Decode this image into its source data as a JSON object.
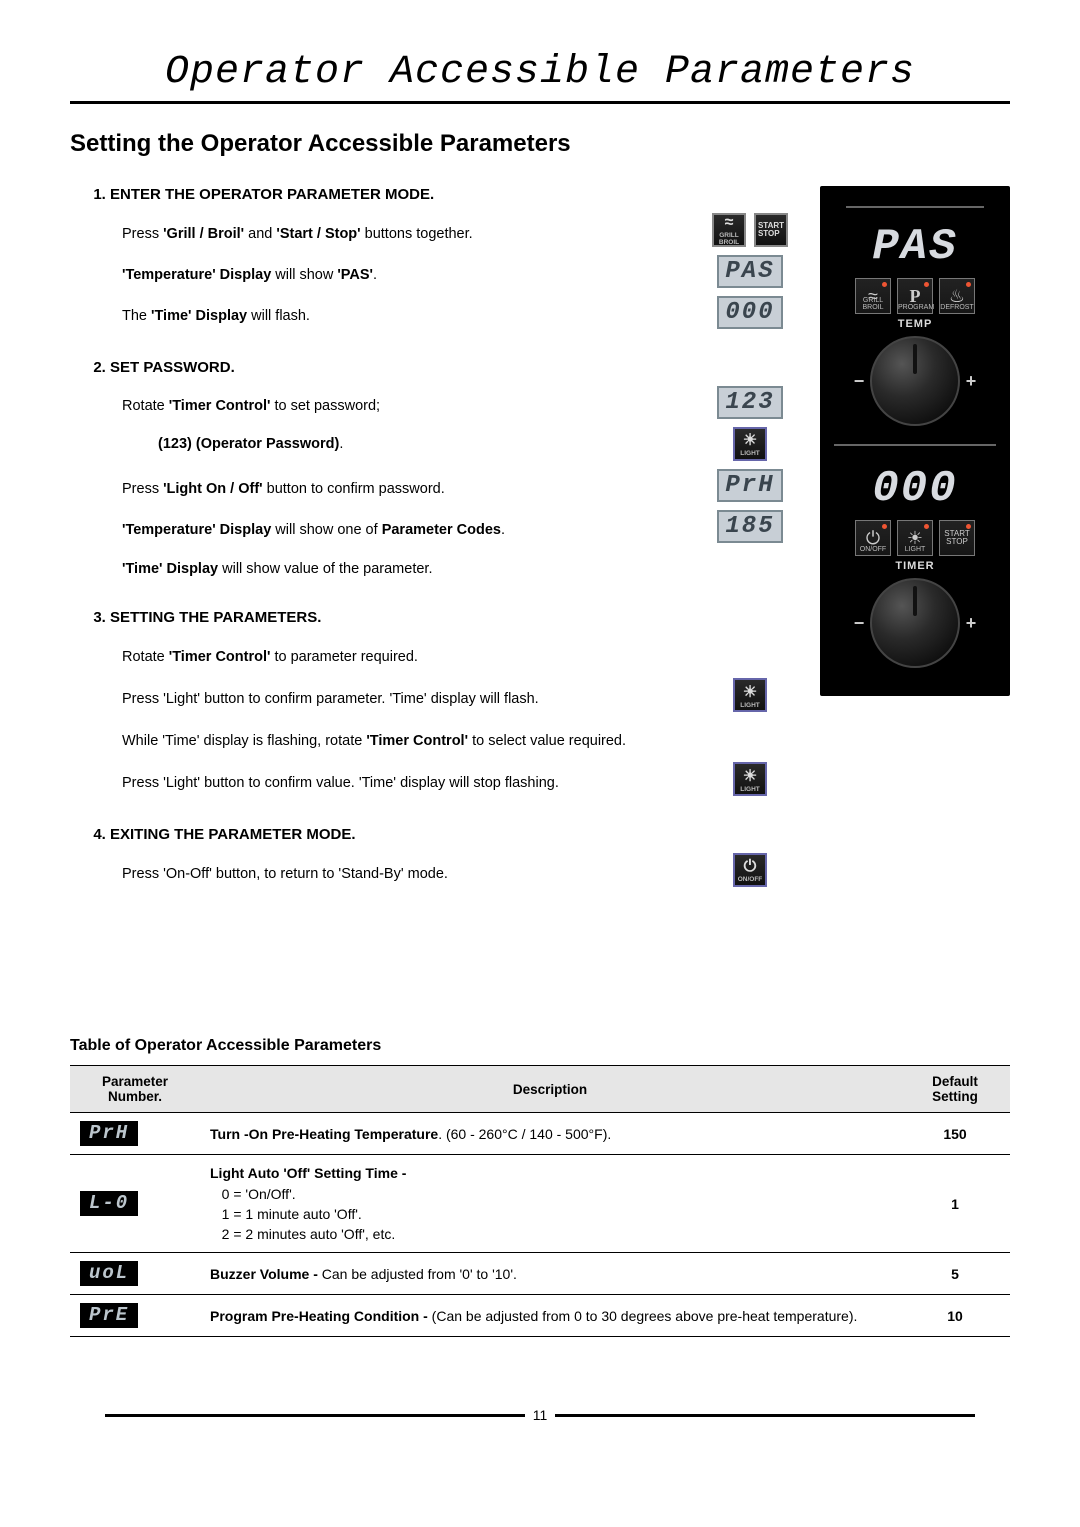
{
  "page": {
    "title": "Operator Accessible Parameters",
    "section_title": "Setting the Operator Accessible Parameters",
    "table_title": "Table of Operator Accessible Parameters",
    "number": "11"
  },
  "steps": [
    {
      "title": "Enter the Operator Parameter Mode.",
      "lines": [
        {
          "html": "Press <b>'Grill / Broil'</b> and <b>'Start / Stop'</b> buttons together."
        },
        {
          "html": "<b>'Temperature' Display</b> will show <b>'PAS'</b>."
        },
        {
          "html": "The <b>'Time' Display</b> will flash."
        }
      ],
      "icons": [
        "grill-start-pair",
        "lcd-PAS",
        "lcd-000"
      ]
    },
    {
      "title": "Set Password.",
      "lines": [
        {
          "html": "Rotate <b>'Timer Control'</b> to set password;"
        },
        {
          "html": "<span class='indent-sub'>(123) (Operator Password)</span>.",
          "raw": true
        },
        {
          "html": "Press <b>'Light On / Off'</b> button to confirm password."
        },
        {
          "html": "<b>'Temperature' Display</b> will show one of <b>Parameter Codes</b>."
        },
        {
          "html": "<b>'Time' Display</b> will show value of the parameter."
        }
      ],
      "icons": [
        "lcd-123",
        "light-btn",
        "lcd-PrH",
        "lcd-185"
      ]
    },
    {
      "title": "Setting the Parameters.",
      "lines": [
        {
          "html": "Rotate <b>'Timer Control'</b> to parameter required."
        },
        {
          "html": "Press 'Light' button to confirm parameter.  'Time' display will flash."
        },
        {
          "html": "While 'Time' display is flashing, rotate <b>'Timer Control'</b> to select value required."
        },
        {
          "html": "Press 'Light' button to confirm value.  'Time' display will stop flashing."
        }
      ],
      "icons": [
        "blank",
        "light-btn",
        "blank",
        "light-btn"
      ]
    },
    {
      "title": "Exiting the Parameter Mode.",
      "lines": [
        {
          "html": "Press 'On-Off' button, to return to 'Stand-By' mode."
        }
      ],
      "icons": [
        "power-btn"
      ]
    }
  ],
  "panel": {
    "top_display": "PAS",
    "top_buttons": [
      "grill",
      "P",
      "thaw"
    ],
    "top_button_labels": [
      "GRILL BROIL",
      "PROGRAM",
      "DEFROST"
    ],
    "temp_label": "TEMP",
    "bottom_display": "000",
    "bottom_buttons": [
      "power",
      "light",
      "start"
    ],
    "bottom_button_labels": [
      "ON/OFF",
      "LIGHT",
      "START STOP"
    ],
    "timer_label": "TIMER"
  },
  "lcd_values": {
    "PAS": "PAS",
    "000": "000",
    "123": "123",
    "PrH": "PrH",
    "185": "185"
  },
  "table": {
    "headers": [
      "Parameter Number.",
      "Description",
      "Default Setting"
    ],
    "rows": [
      {
        "code": "PrH",
        "desc": "<b>Turn -On Pre-Heating Temperature</b>.  (60 - 260°C / 140 - 500°F).",
        "default": "150"
      },
      {
        "code": "L-0",
        "desc": "<b>Light Auto 'Off' Setting Time -</b><br>&nbsp;&nbsp;&nbsp;0 = 'On/Off'.<br>&nbsp;&nbsp;&nbsp;1 = 1 minute auto 'Off'.<br>&nbsp;&nbsp;&nbsp;2 = 2 minutes auto 'Off', etc.",
        "default": "1"
      },
      {
        "code": "uoL",
        "desc": "<b>Buzzer Volume -</b> Can be adjusted from '0' to '10'.",
        "default": "5"
      },
      {
        "code": "PrE",
        "desc": "<b>Program Pre-Heating Condition -</b> (Can be adjusted from 0 to 30 degrees above pre-heat temperature).",
        "default": "10"
      }
    ]
  }
}
